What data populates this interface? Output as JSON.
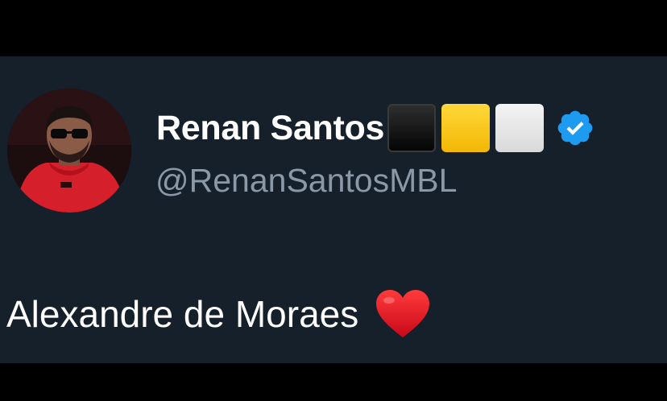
{
  "tweet": {
    "display_name": "Renan Santos",
    "name_emoji_icons": [
      "black-square-icon",
      "yellow-square-icon",
      "white-square-icon"
    ],
    "verified_icon": "verified-badge-icon",
    "handle": "@RenanSantosMBL",
    "text": "Alexandre de Moraes",
    "text_emoji_icon": "red-heart-icon"
  },
  "colors": {
    "background": "#15202b",
    "frame": "#000000",
    "name": "#ffffff",
    "handle": "#8b98a5",
    "verified": "#1d9bf0",
    "heart": "#e0101e"
  }
}
